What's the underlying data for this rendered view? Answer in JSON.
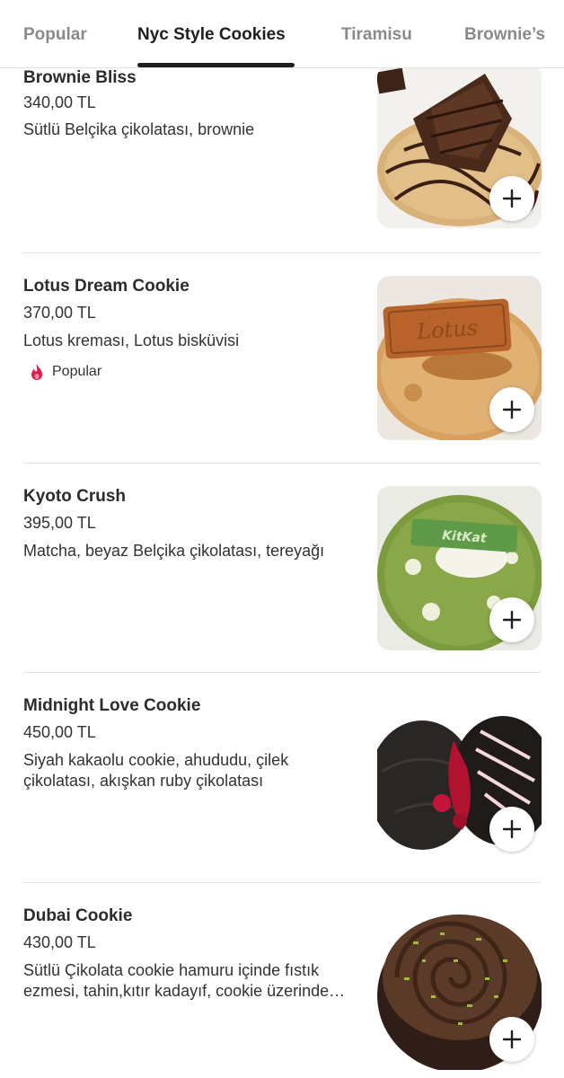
{
  "tabs": [
    {
      "label": "Popular",
      "active": false
    },
    {
      "label": "Nyc Style Cookies",
      "active": true
    },
    {
      "label": "Tiramisu",
      "active": false
    },
    {
      "label": "Brownie’s",
      "active": false
    }
  ],
  "items": [
    {
      "name": "Brownie Bliss",
      "price": "340,00 TL",
      "desc": "Sütlü Belçika çikolatası, brownie",
      "image": "brownie-cookie-image"
    },
    {
      "name": "Lotus Dream Cookie",
      "price": "370,00 TL",
      "desc": "Lotus kreması, Lotus bisküvisi",
      "badge": "Popular",
      "badge_icon": "flame-icon",
      "image": "lotus-cookie-image"
    },
    {
      "name": "Kyoto Crush",
      "price": "395,00 TL",
      "desc": "Matcha, beyaz Belçika çikolatası, tereyağı",
      "image": "matcha-cookie-image"
    },
    {
      "name": "Midnight Love Cookie",
      "price": "450,00 TL",
      "desc": "Siyah kakaolu cookie, ahududu, çilek çikolatası, akışkan ruby çikolatası",
      "image": "dark-cookie-image"
    },
    {
      "name": "Dubai Cookie",
      "price": "430,00 TL",
      "desc": "Sütlü Çikolata cookie hamuru içinde fıstık ezmesi, tahin,kıtır kadayıf, cookie üzerinde fıstık kreması",
      "image": "dubai-cookie-image"
    }
  ],
  "image_labels": {
    "lotus_text": "Lotus",
    "kitkat_text": "KitKat"
  },
  "colors": {
    "accent_flame": "#e0194f",
    "active_tab": "#1f1f1f",
    "inactive_tab": "#8a8a8a"
  }
}
